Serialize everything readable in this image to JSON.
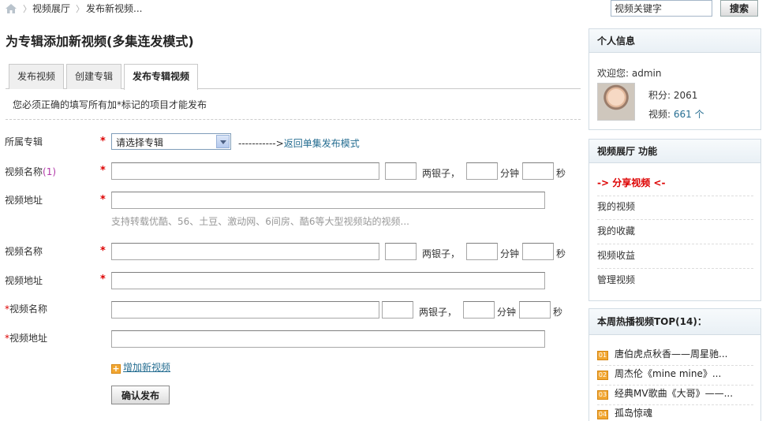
{
  "breadcrumb": [
    "视频展厅",
    "发布新视频..."
  ],
  "search": {
    "placeholder": "视频关键字",
    "button": "搜索"
  },
  "page_title": "为专辑添加新视频(多集连发模式)",
  "tabs": [
    "发布视频",
    "创建专辑",
    "发布专辑视频"
  ],
  "notice": "您必须正确的填写所有加*标记的项目才能发布",
  "form": {
    "album_label": "所属专辑",
    "album_select": "请选择专辑",
    "back_link_prefix": "----------->",
    "back_link": "返回单集发布模式",
    "video_name": "视频名称",
    "video_index": "(1)",
    "video_url": "视频地址",
    "silver_unit": "两银子，",
    "minute_unit": "分钟",
    "second_unit": "秒",
    "hint": "支持转载优酷、56、土豆、激动网、6间房、酷6等大型视频站的视频...",
    "add_link": "增加新视频",
    "submit": "确认发布",
    "required_mark": "*"
  },
  "sidebar": {
    "profile_title": "个人信息",
    "welcome": "欢迎您: admin",
    "points_label": "积分: 2061",
    "videos_label": "视频: ",
    "videos_count": "661 个",
    "functions_title": "视频展厅 功能",
    "functions": [
      "-> 分享视频 <-",
      "我的视频",
      "我的收藏",
      "视频收益",
      "管理视频"
    ],
    "top_title": "本周热播视频TOP(14)：",
    "top": [
      {
        "rank": "01",
        "title": "唐伯虎点秋香——周星驰..."
      },
      {
        "rank": "02",
        "title": "周杰伦《mine mine》..."
      },
      {
        "rank": "03",
        "title": "经典MV歌曲《大哥》——..."
      },
      {
        "rank": "04",
        "title": "孤岛惊魂"
      }
    ]
  }
}
